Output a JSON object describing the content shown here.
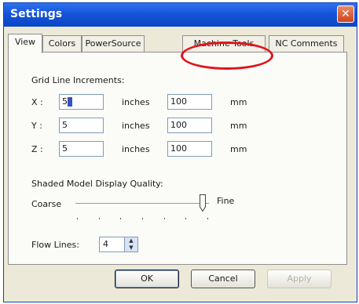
{
  "window": {
    "title": "Settings",
    "close_symbol": "✕"
  },
  "tabs": [
    {
      "label": "View",
      "active": true
    },
    {
      "label": "Colors",
      "active": false
    },
    {
      "label": "PowerSource",
      "active": false
    },
    {
      "label": "Machine Tools",
      "active": false,
      "highlighted": true
    },
    {
      "label": "NC Comments",
      "active": false
    }
  ],
  "grid": {
    "heading": "Grid Line Increments:",
    "rows": [
      {
        "axis": "X :",
        "inches_value": "5",
        "inches_unit": "inches",
        "mm_value": "100",
        "mm_unit": "mm"
      },
      {
        "axis": "Y :",
        "inches_value": "5",
        "inches_unit": "inches",
        "mm_value": "100",
        "mm_unit": "mm"
      },
      {
        "axis": "Z :",
        "inches_value": "5",
        "inches_unit": "inches",
        "mm_value": "100",
        "mm_unit": "mm"
      }
    ]
  },
  "quality": {
    "heading": "Shaded Model Display Quality:",
    "min_label": "Coarse",
    "max_label": "Fine",
    "level": 0.95
  },
  "flow_lines": {
    "label": "Flow Lines:",
    "value": "4"
  },
  "buttons": {
    "ok": "OK",
    "cancel": "Cancel",
    "apply": "Apply"
  },
  "colors": {
    "title_bar": "#1554d8",
    "close_button": "#d0441b",
    "callout": "#e0141c"
  }
}
